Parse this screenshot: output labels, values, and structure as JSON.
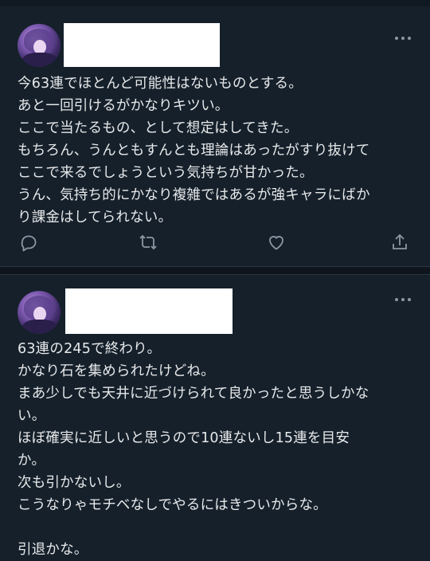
{
  "tweets": [
    {
      "text": "今63連でほとんど可能性はないものとする。\nあと一回引けるがかなりキツい。\nここで当たるもの、として想定はしてきた。\nもちろん、うんともすんとも理論はあったがすり抜けて\nここで来るでしょうという気持ちが甘かった。\nうん、気持ち的にかなり複雑ではあるが強キャラにばか\nり課金はしてられない。",
      "actions": [
        "reply-icon",
        "retweet-icon",
        "like-icon",
        "share-icon"
      ]
    },
    {
      "text": "63連の245で終わり。\nかなり石を集められたけどね。\nまあ少しでも天井に近づけられて良かったと思うしかな\nい。\nほぼ確実に近しいと思うので10連ないし15連を目安\nか。\n次も引かないし。\nこうなりゃモチベなしでやるにはきついからな。\n\n引退かな。"
    }
  ],
  "colors": {
    "background": "#15202b",
    "text": "#e7e9ea",
    "icon": "#8b98a5"
  }
}
